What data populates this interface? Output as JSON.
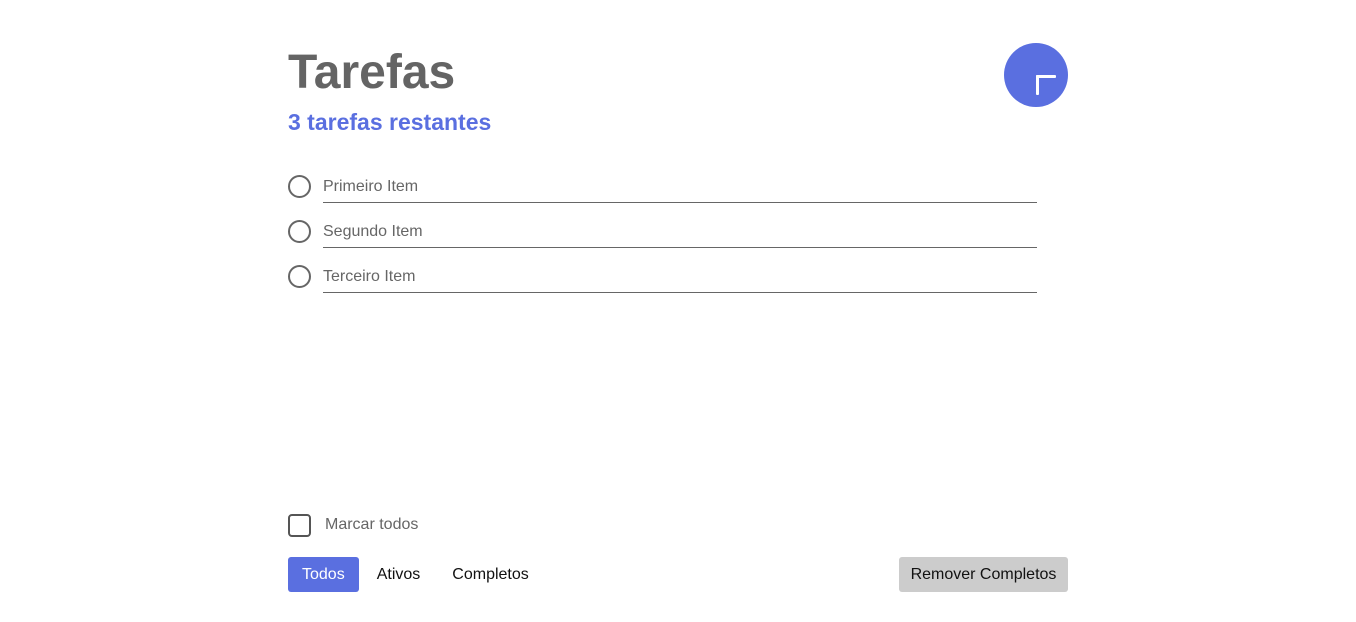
{
  "colors": {
    "accent": "#5a6fe0",
    "title": "#646464",
    "text": "#666666",
    "remove_bg": "#cccccc"
  },
  "header": {
    "title": "Tarefas",
    "remaining": "3 tarefas restantes",
    "add_icon": "plus-icon"
  },
  "todos": [
    {
      "text": "Primeiro Item",
      "completed": false
    },
    {
      "text": "Segundo Item",
      "completed": false
    },
    {
      "text": "Terceiro Item",
      "completed": false
    }
  ],
  "footer": {
    "mark_all_label": "Marcar todos",
    "filters": [
      {
        "label": "Todos",
        "active": true
      },
      {
        "label": "Ativos",
        "active": false
      },
      {
        "label": "Completos",
        "active": false
      }
    ],
    "remove_completed_label": "Remover Completos"
  }
}
